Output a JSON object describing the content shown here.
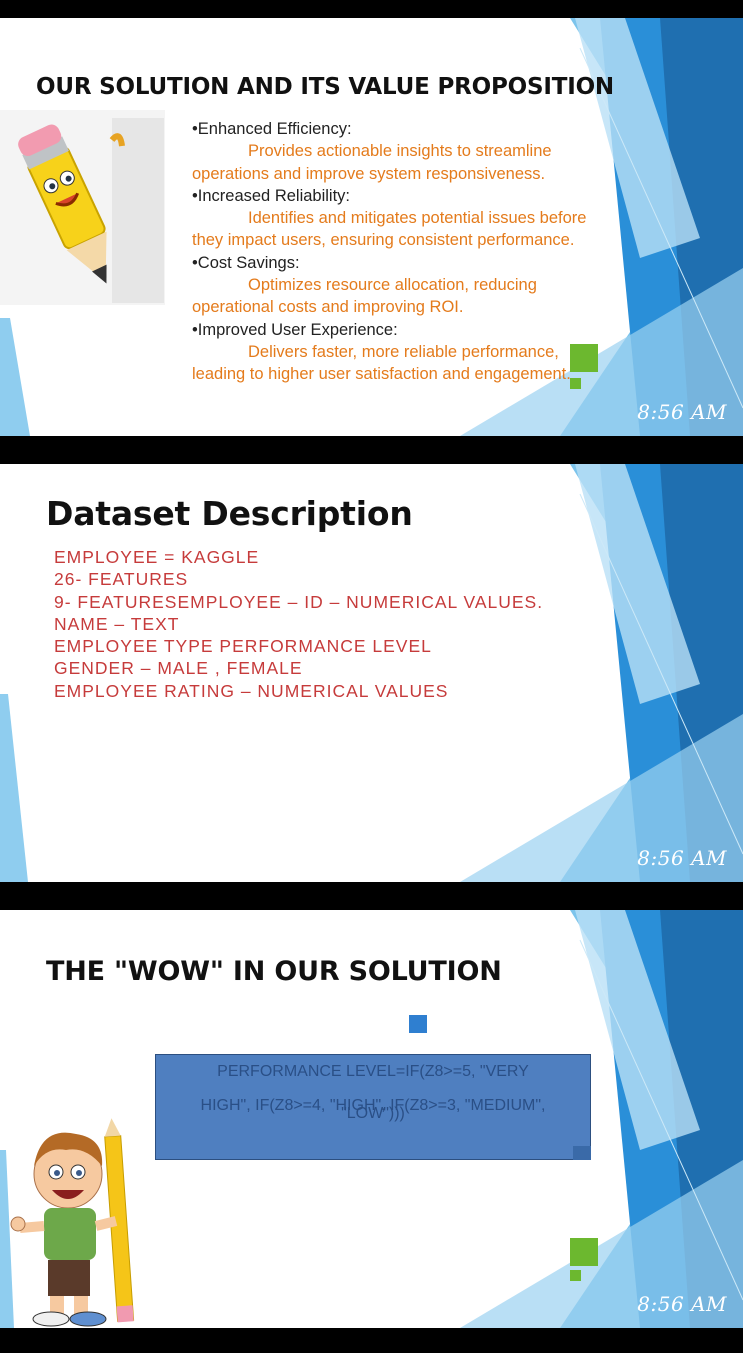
{
  "slides": [
    {
      "title": "OUR SOLUTION AND ITS VALUE PROPOSITION",
      "time": "8:56 AM",
      "bullets": [
        {
          "heading": "•Enhanced Efficiency:",
          "desc_first": "Provides actionable insights to streamline",
          "desc_rest": "operations and improve system responsiveness."
        },
        {
          "heading": "•Increased Reliability:",
          "desc_first": "Identifies and mitigates potential issues before",
          "desc_rest": "they impact users, ensuring consistent performance."
        },
        {
          "heading": "•Cost Savings:",
          "desc_first": "Optimizes resource allocation, reducing",
          "desc_rest": "operational costs and improving ROI."
        },
        {
          "heading": "•Improved User Experience:",
          "desc_first": "Delivers faster, more reliable performance,",
          "desc_rest": "leading to higher user satisfaction and engagement."
        }
      ]
    },
    {
      "title": "Dataset Description",
      "time": "8:56 AM",
      "lines": [
        "EMPLOYEE = KAGGLE",
        "26- FEATURES",
        "9- FEATURESEMPLOYEE – ID – NUMERICAL VALUES.",
        "NAME – TEXT",
        "EMPLOYEE TYPE PERFORMANCE LEVEL",
        "GENDER – MALE , FEMALE",
        "EMPLOYEE RATING – NUMERICAL VALUES"
      ]
    },
    {
      "title": "THE \"WOW\" IN OUR SOLUTION",
      "time": "8:56 AM",
      "formula_line1": "PERFORMANCE LEVEL=IF(Z8>=5, \"VERY",
      "formula_line2": "HIGH\", IF(Z8>=4, \"HIGH\", IF(Z8>=3, \"MEDIUM\",",
      "formula_line3": "\"LOW\")))"
    }
  ],
  "colors": {
    "accent_orange": "#e47b1c",
    "dataset_red": "#c63b3b",
    "formula_box": "#4f7fc0",
    "deco_blue": "#2a8fd8"
  },
  "icons": [
    "pencil-mascot",
    "boy-with-pencil-mascot"
  ]
}
